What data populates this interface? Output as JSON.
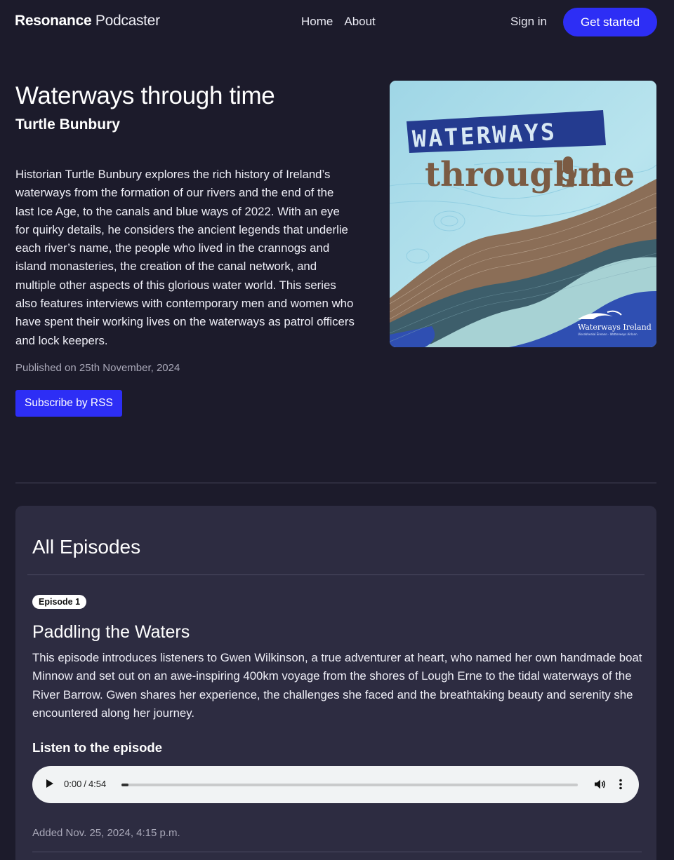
{
  "header": {
    "brand_bold": "Resonance",
    "brand_light": "Podcaster",
    "nav": [
      {
        "label": "Home"
      },
      {
        "label": "About"
      }
    ],
    "signin_label": "Sign in",
    "cta_label": "Get started"
  },
  "show": {
    "title": "Waterways through time",
    "author": "Turtle Bunbury",
    "description": "Historian Turtle Bunbury explores the rich history of Ireland’s waterways from the formation of our rivers and the end of the last Ice Age, to the canals and blue ways of 2022. With an eye for quirky details, he considers the ancient legends that underlie each river’s name, the people who lived in the crannogs and island monasteries, the creation of the canal network, and multiple other aspects of this glorious water world. This series also features interviews with contemporary men and women who have spent their working lives on the waterways as patrol officers and lock keepers.",
    "published": "Published on 25th November, 2024",
    "rss_label": "Subscribe by RSS",
    "cover": {
      "word1": "WATERWAYS",
      "word2_a": "through t",
      "word2_b": "me",
      "logo_text": "Waterways Ireland",
      "logo_sub": "Uiscebhealaí Éireann · Watterweys Airlann"
    }
  },
  "episodes": {
    "heading": "All Episodes",
    "items": [
      {
        "badge": "Episode 1",
        "title": "Paddling the Waters",
        "description": "This episode introduces listeners to Gwen Wilkinson, a true adventurer at heart, who named her own handmade boat Minnow and set out on an awe-inspiring 400km voyage from the shores of Lough Erne to the tidal waterways of the River Barrow. Gwen shares her experience, the challenges she faced and the breathtaking beauty and serenity she encountered along her journey.",
        "listen_label": "Listen to the episode",
        "player": {
          "current": "0:00",
          "duration": "4:54",
          "progress": 0.01
        },
        "added": "Added Nov. 25, 2024, 4:15 p.m."
      }
    ]
  },
  "colors": {
    "background": "#1c1b2b",
    "panel": "#2d2c41",
    "accent": "#2d2ef5",
    "muted_text": "#a9a8b8"
  },
  "icons": [
    "play-icon",
    "volume-icon",
    "more-vertical-icon",
    "microphone-icon",
    "heron-logo-icon"
  ]
}
